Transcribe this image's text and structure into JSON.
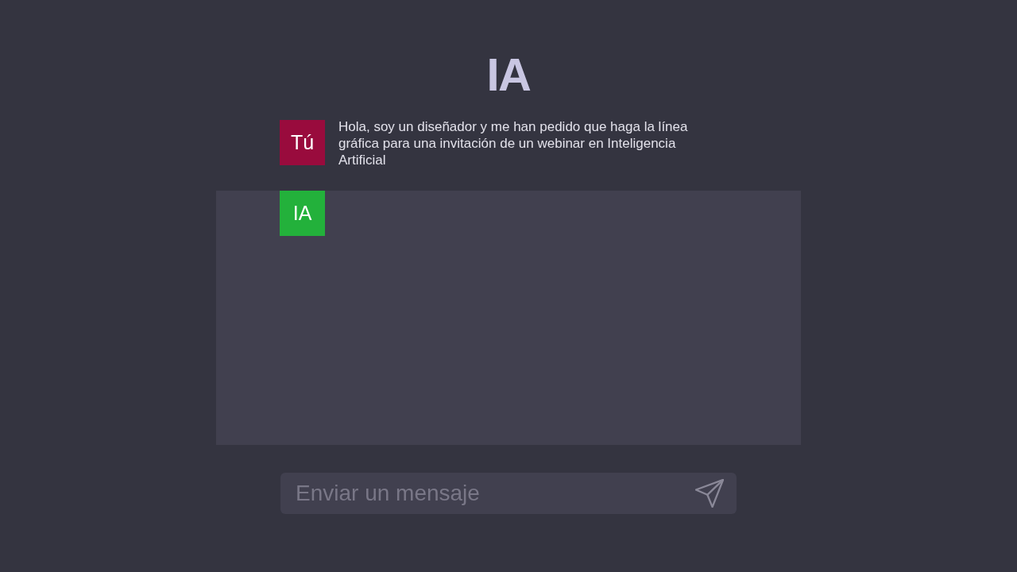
{
  "header": {
    "title": "IA"
  },
  "messages": [
    {
      "kind": "user",
      "sender": "Tú",
      "color": "#990b3d",
      "text": "Hola, soy un diseñador y me han pedido que haga la línea gráfica para una invitación de un webinar en Inteligencia Artificial"
    },
    {
      "kind": "assistant",
      "sender": "IA",
      "color": "#23b13b"
    }
  ],
  "composer": {
    "placeholder": "Enviar un mensaje"
  }
}
